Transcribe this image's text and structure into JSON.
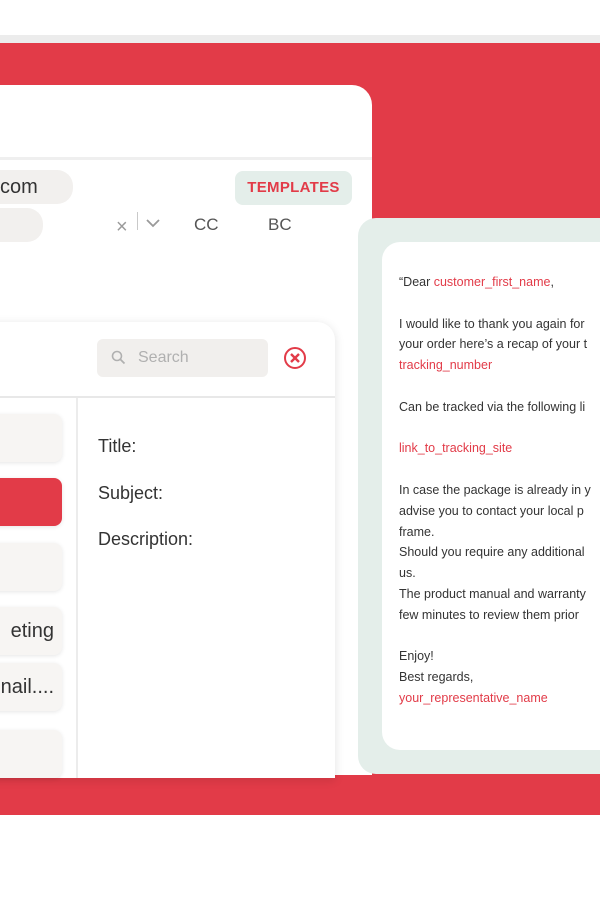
{
  "composer": {
    "to_value": "com",
    "templates_label": "TEMPLATES",
    "clear_symbol": "×",
    "cc_label": "CC",
    "bc_label": "BC"
  },
  "dialog": {
    "search_placeholder": "Search",
    "list_items": [
      "",
      "",
      "",
      "eting",
      "nail....",
      ""
    ],
    "active_item_index": 1,
    "fields": {
      "title": "Title:",
      "subject": "Subject:",
      "description": "Description:"
    }
  },
  "preview": {
    "greeting_prefix": "“Dear ",
    "greeting_var": "customer_first_name",
    "greeting_suffix": ",",
    "line_thanks_1": "I would like to thank you again for",
    "line_thanks_2": "your order here’s a recap of your t",
    "tracking_var": "tracking_number",
    "line_tracked": "Can be tracked via the following li",
    "link_var": "link_to_tracking_site",
    "line_case_1": "In case the package is already in y",
    "line_case_2": "advise you to contact your local p",
    "line_case_3": "frame.",
    "line_should_1": "Should you require any additional",
    "line_should_2": "us.",
    "line_manual_1": "The product manual and warranty",
    "line_manual_2": "few minutes to review them prior",
    "line_enjoy": "Enjoy!",
    "line_regards": "Best regards,",
    "rep_var": "your_representative_name"
  },
  "colors": {
    "brand_red": "#e23b48",
    "mint": "#e4eeea",
    "chip_gray": "#f2f0ee"
  }
}
